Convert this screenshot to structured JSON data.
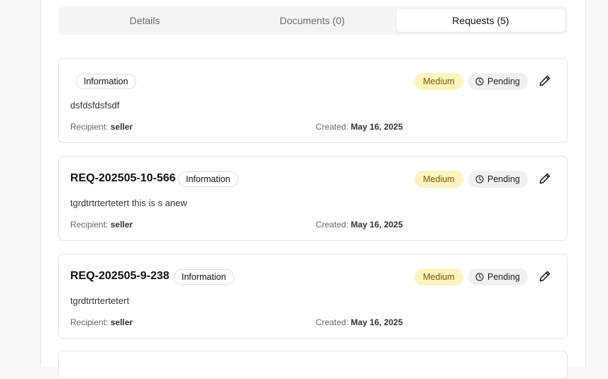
{
  "tabs": [
    {
      "label": "Details"
    },
    {
      "label": "Documents (0)"
    },
    {
      "label": "Requests (5)"
    }
  ],
  "requests": [
    {
      "id": "",
      "category": "Information",
      "priority": "Medium",
      "status": "Pending",
      "description": "dsfdsfdsfsdf",
      "recipient_label": "Recipient:",
      "recipient": "seller",
      "created_label": "Created:",
      "created": "May 16, 2025"
    },
    {
      "id": "REQ-202505-10-566",
      "category": "Information",
      "priority": "Medium",
      "status": "Pending",
      "description": "tgrdtrtrtertetert this is s anew",
      "recipient_label": "Recipient:",
      "recipient": "seller",
      "created_label": "Created:",
      "created": "May 16, 2025"
    },
    {
      "id": "REQ-202505-9-238",
      "category": "Information",
      "priority": "Medium",
      "status": "Pending",
      "description": "tgrdtrtrtertetert",
      "recipient_label": "Recipient:",
      "recipient": "seller",
      "created_label": "Created:",
      "created": "May 16, 2025"
    }
  ],
  "colors": {
    "medium_bg": "#fdf3bf",
    "medium_text": "#7a5a00",
    "pending_bg": "#eef0f2",
    "active_tab_bg": "#ffffff",
    "tabs_bg": "#f4f4f4"
  },
  "icons": {
    "status_icon": "clock-icon",
    "edit_icon": "pencil-icon"
  }
}
